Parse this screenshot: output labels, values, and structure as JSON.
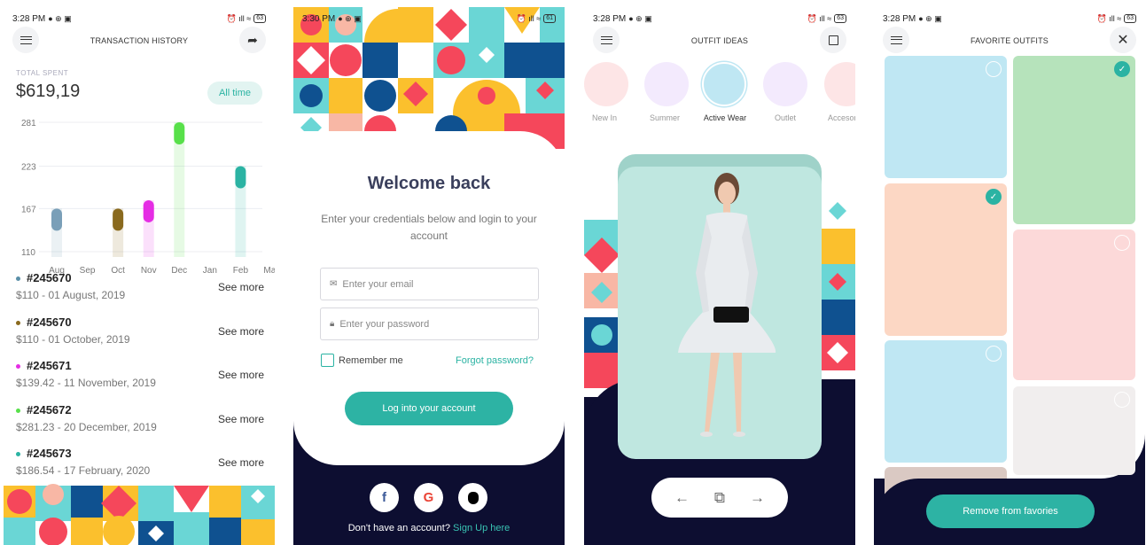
{
  "screen1": {
    "status": {
      "time": "3:28 PM",
      "battery": "63"
    },
    "title": "TRANSACTION HISTORY",
    "total_label": "TOTAL SPENT",
    "total_value": "$619,19",
    "filter_label": "All time",
    "transactions": [
      {
        "id": "#245670",
        "sub": "$110 - 01 August, 2019",
        "more": "See more",
        "color": "#5a8fa8"
      },
      {
        "id": "#245670",
        "sub": "$110 - 01 October, 2019",
        "more": "See more",
        "color": "#8a6a1e"
      },
      {
        "id": "#245671",
        "sub": "$139.42 - 11 November, 2019",
        "more": "See more",
        "color": "#e52de4"
      },
      {
        "id": "#245672",
        "sub": "$281.23 - 20 December, 2019",
        "more": "See more",
        "color": "#58e04a"
      },
      {
        "id": "#245673",
        "sub": "$186.54 - 17 February, 2020",
        "more": "See more",
        "color": "#2bb3a3"
      }
    ]
  },
  "chart_data": {
    "type": "bar",
    "categories": [
      "Aug",
      "Sep",
      "Oct",
      "Nov",
      "Dec",
      "Jan",
      "Feb",
      "Mar"
    ],
    "values": [
      167,
      null,
      167,
      178,
      281,
      null,
      223,
      null
    ],
    "colors": [
      "#7a9fb8",
      null,
      "#8a6a1e",
      "#e52de4",
      "#58e04a",
      null,
      "#2bb3a3",
      null
    ],
    "y_ticks": [
      "281",
      "223",
      "167",
      "110"
    ],
    "ylim": [
      110,
      281
    ],
    "grid": true
  },
  "screen2": {
    "status": {
      "time": "3:30 PM",
      "battery": "61"
    },
    "welcome": "Welcome back",
    "credentials_text": "Enter your credentials below and login to your account",
    "email_placeholder": "Enter your email",
    "password_placeholder": "Enter your password",
    "remember_label": "Remember me",
    "forgot_label": "Forgot password?",
    "login_label": "Log into your account",
    "social": {
      "facebook": "f",
      "google": "G",
      "apple": ""
    },
    "no_account": "Don't have an account?",
    "signup_label": "Sign Up here"
  },
  "screen3": {
    "status": {
      "time": "3:28 PM",
      "battery": "63"
    },
    "title": "OUTFIT IDEAS",
    "categories": [
      {
        "label": "New In",
        "color": "#fde5e6"
      },
      {
        "label": "Summer",
        "color": "#f3eafd"
      },
      {
        "label": "Active Wear",
        "color": "#bfe7f3"
      },
      {
        "label": "Outlet",
        "color": "#f3eafd"
      },
      {
        "label": "Accesories",
        "color": "#fde5e6"
      }
    ]
  },
  "screen4": {
    "status": {
      "time": "3:28 PM",
      "battery": "63"
    },
    "title": "FAVORITE OUTFITS",
    "remove_label": "Remove from favories"
  },
  "colors": {
    "teal": "#2db3a4",
    "navy": "#0d0e31",
    "red": "#f5475b",
    "yellow": "#fbc02d",
    "blue": "#0f5190",
    "aqua": "#6ad6d5"
  }
}
